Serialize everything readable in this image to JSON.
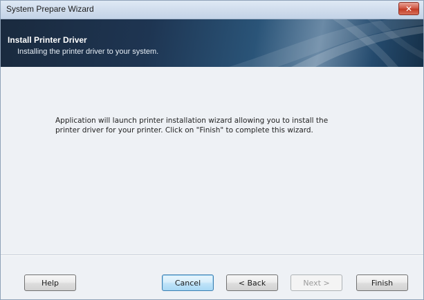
{
  "window": {
    "title": "System Prepare Wizard",
    "close_glyph": "✕"
  },
  "banner": {
    "title": "Install Printer Driver",
    "subtitle": "Installing the printer driver to your system."
  },
  "content": {
    "message": "Application will launch printer installation wizard allowing you to install the printer driver for your printer. Click on \"Finish\" to complete this wizard."
  },
  "buttons": {
    "help": "Help",
    "cancel": "Cancel",
    "back": "< Back",
    "next": "Next >",
    "finish": "Finish"
  },
  "colors": {
    "banner_dark": "#1a2a3e",
    "close_red": "#c23b26",
    "default_button": "#a8d8f5"
  }
}
